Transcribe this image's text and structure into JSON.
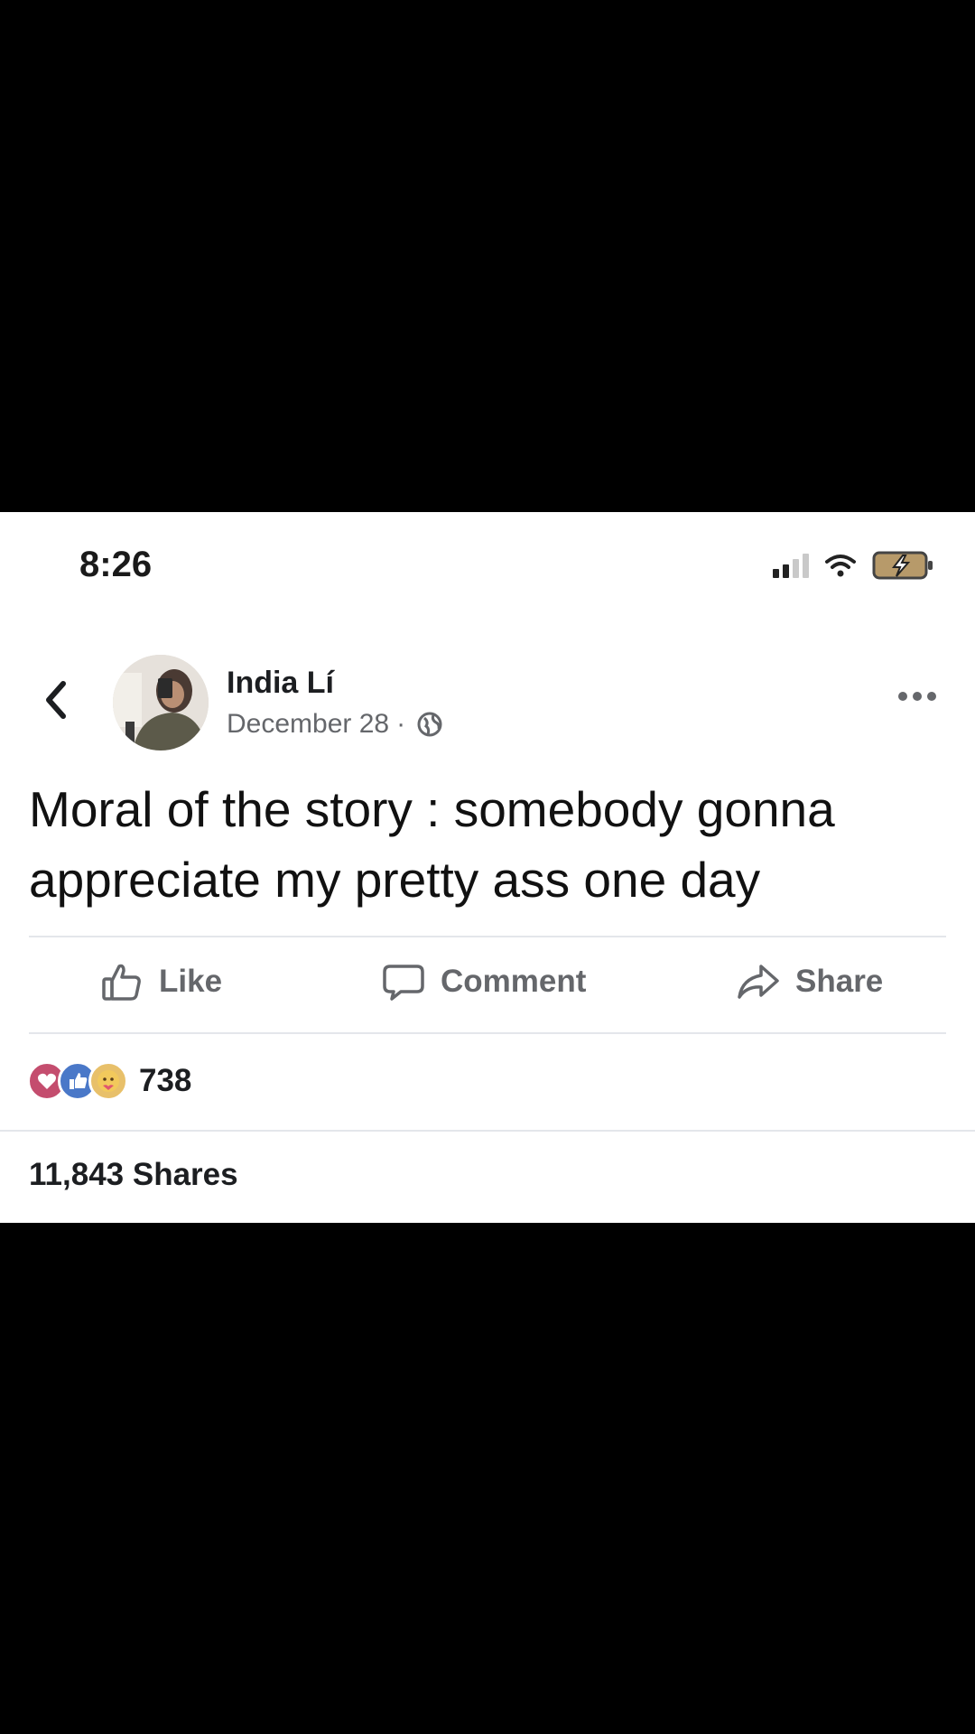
{
  "status_bar": {
    "time": "8:26",
    "icons": [
      "signal-icon",
      "wifi-icon",
      "battery-charging-icon"
    ]
  },
  "post": {
    "author": "India Lí",
    "date": "December 28",
    "separator": "·",
    "audience_icon": "globe-icon",
    "text": "Moral of the story : somebody gonna appreciate my pretty ass one day"
  },
  "actions": {
    "like": "Like",
    "comment": "Comment",
    "share": "Share"
  },
  "stats": {
    "reaction_icons": [
      "love-reaction-icon",
      "like-reaction-icon",
      "care-reaction-icon"
    ],
    "reaction_count": "738",
    "shares": "11,843 Shares"
  },
  "colors": {
    "background": "#000000",
    "card": "#ffffff",
    "secondary_text": "#65676b",
    "love": "#c44d6e",
    "like": "#4a78c8",
    "care": "#e8c06a"
  }
}
